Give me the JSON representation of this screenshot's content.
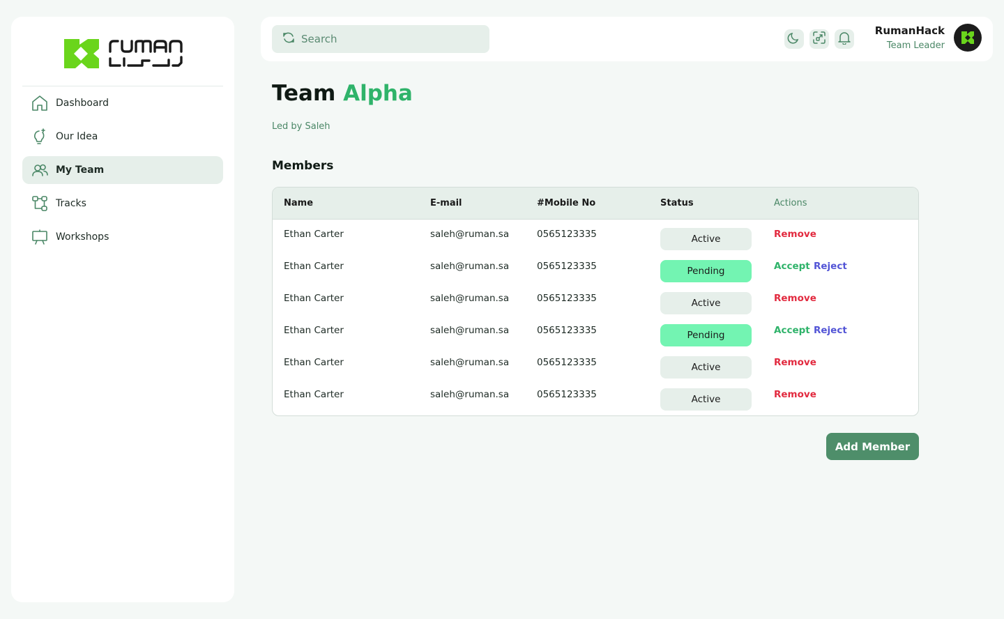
{
  "brand": {
    "logo_alt": "ruman",
    "accent": "#6ad51c"
  },
  "sidebar": {
    "items": [
      {
        "label": "Dashboard",
        "icon": "home-icon",
        "active": false
      },
      {
        "label": "Our Idea",
        "icon": "lightbulb-icon",
        "active": false
      },
      {
        "label": "My Team",
        "icon": "users-icon",
        "active": true
      },
      {
        "label": "Tracks",
        "icon": "route-icon",
        "active": false
      },
      {
        "label": "Workshops",
        "icon": "presentation-icon",
        "active": false
      }
    ]
  },
  "header": {
    "search_placeholder": "Search",
    "user_name": "RumanHack",
    "user_role": "Team Leader",
    "tools": [
      "moon-icon",
      "scan-icon",
      "bell-icon"
    ]
  },
  "page": {
    "title_prefix": "Team",
    "title_accent": "Alpha",
    "subtitle": "Led by Saleh",
    "section_title": "Members"
  },
  "table": {
    "headers": {
      "name": "Name",
      "email": "E-mail",
      "mobile": "#Mobile No",
      "status": "Status",
      "actions": "Actions"
    },
    "rows": [
      {
        "name": "Ethan Carter",
        "email": "saleh@ruman.sa",
        "mobile": "0565123335",
        "status": "Active",
        "actions": [
          "Remove"
        ]
      },
      {
        "name": "Ethan Carter",
        "email": "saleh@ruman.sa",
        "mobile": "0565123335",
        "status": "Pending",
        "actions": [
          "Accept",
          "Reject"
        ]
      },
      {
        "name": "Ethan Carter",
        "email": "saleh@ruman.sa",
        "mobile": "0565123335",
        "status": "Active",
        "actions": [
          "Remove"
        ]
      },
      {
        "name": "Ethan Carter",
        "email": "saleh@ruman.sa",
        "mobile": "0565123335",
        "status": "Pending",
        "actions": [
          "Accept",
          "Reject"
        ]
      },
      {
        "name": "Ethan Carter",
        "email": "saleh@ruman.sa",
        "mobile": "0565123335",
        "status": "Active",
        "actions": [
          "Remove"
        ]
      },
      {
        "name": "Ethan Carter",
        "email": "saleh@ruman.sa",
        "mobile": "0565123335",
        "status": "Active",
        "actions": [
          "Remove"
        ]
      }
    ]
  },
  "buttons": {
    "add_member": "Add Member"
  },
  "colors": {
    "active_badge": "#e6efea",
    "pending_badge": "#73f4b2",
    "remove": "#e22a3f",
    "accept": "#2fb36a",
    "reject": "#5254d6",
    "primary_button": "#4e8e6a"
  }
}
